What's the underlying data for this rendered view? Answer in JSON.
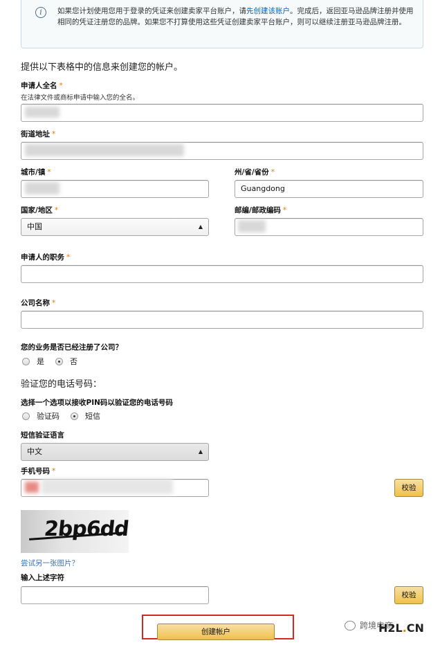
{
  "info": {
    "text_before_link": "如果您计划使用您用于登录的凭证来创建卖家平台账户，请",
    "link": "先创建该账户",
    "text_after_link": "。完成后，返回亚马逊品牌注册并使用相同的凭证注册您的品牌。如果您不打算使用这些凭证创建卖家平台账户，则可以继续注册亚马逊品牌注册。"
  },
  "form": {
    "heading": "提供以下表格中的信息来创建您的帐户。",
    "required_mark": "*",
    "applicant_name": {
      "label": "申请人全名",
      "hint": "在法律文件或商标申请中输入您的全名。"
    },
    "street": {
      "label": "街道地址"
    },
    "city": {
      "label": "城市/镇"
    },
    "state": {
      "label": "州/省/省份",
      "value": "Guangdong"
    },
    "country": {
      "label": "国家/地区",
      "selected": "中国"
    },
    "postal": {
      "label": "邮编/邮政编码"
    },
    "title": {
      "label": "申请人的职务"
    },
    "company": {
      "label": "公司名称"
    },
    "registered": {
      "label": "您的业务是否已经注册了公司？",
      "options": [
        "是",
        "否"
      ],
      "selected_index": 1
    }
  },
  "phone": {
    "heading": "验证您的电话号码：",
    "method": {
      "label": "选择一个选项以接收PIN码以验证您的电话号码",
      "options": [
        "验证码",
        "短信"
      ],
      "selected_index": 1
    },
    "sms_language": {
      "label": "短信验证语言",
      "selected": "中文"
    },
    "mobile": {
      "label": "手机号码"
    },
    "verify_button": "校验"
  },
  "captcha": {
    "image_text": "2bp6dd",
    "refresh_link": "尝试另一张图片？",
    "input_label": "输入上述字符",
    "verify_button": "校验"
  },
  "submit": {
    "label": "创建帐户"
  },
  "watermark": {
    "text": "跨境电商",
    "brand_main": "H2L",
    "brand_dot": ".",
    "brand_tld": "CN"
  },
  "colors": {
    "required": "#e07b00",
    "button": "#f0c14b",
    "link": "#0066c0",
    "highlight": "#d12a20"
  }
}
